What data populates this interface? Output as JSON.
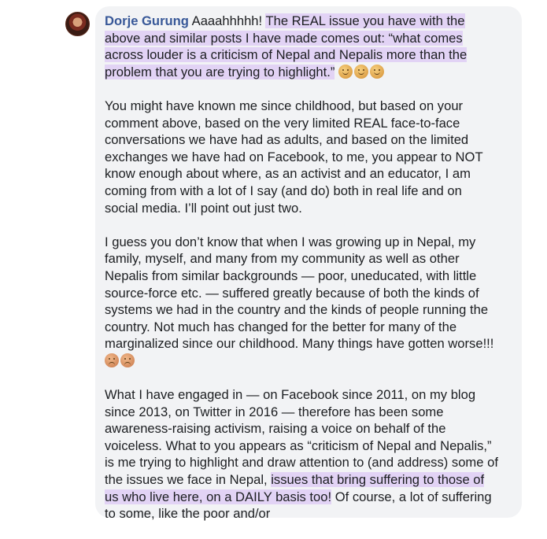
{
  "comment": {
    "author": "Dorje Gurung",
    "p1": {
      "intro": "Aaaahhhhh! ",
      "highlight": "The REAL issue you have with the above and similar posts I have made comes out: “what comes across louder is a criticism of Nepal and Nepalis more than the problem that you are trying to highlight.”",
      "emojis": [
        "smiling-face",
        "smiling-face",
        "smiling-face"
      ]
    },
    "p2": "You might have known me since childhood, but based on your comment above, based on the very limited REAL face-to-face conversations we have had as adults, and based on the limited exchanges we have had on Facebook, to me, you appear to NOT know enough about where, as an activist and an educator, I am coming from with a lot of I say (and do) both in real life and on social media. I’ll point out just two.",
    "p3": {
      "text": "I guess you don’t know that when I was growing up in Nepal, my family, myself, and many from my community as well as other Nepalis from similar backgrounds — poor, uneducated, with little source-force etc. — suffered greatly because of both the kinds of systems we had in the country and the kinds of people running the country. Not much has changed for the better for many of the marginalized since our childhood. Many things have gotten worse!!! ",
      "emojis": [
        "sad-face",
        "sad-face"
      ]
    },
    "p4": {
      "text_before": "What I have engaged in — on Facebook since 2011, on my blog since 2013, on Twitter in 2016 — therefore has been some awareness-raising activism, raising a voice on behalf of the voiceless. What to you appears as “criticism of Nepal and Nepalis,” is me trying to highlight and draw attention to (and address) some of the issues we face in Nepal, ",
      "highlight": "issues that bring suffering to those of us who live here, on a DAILY basis too!",
      "text_after": " Of course, a lot of suffering to some, like the poor and/or"
    }
  }
}
